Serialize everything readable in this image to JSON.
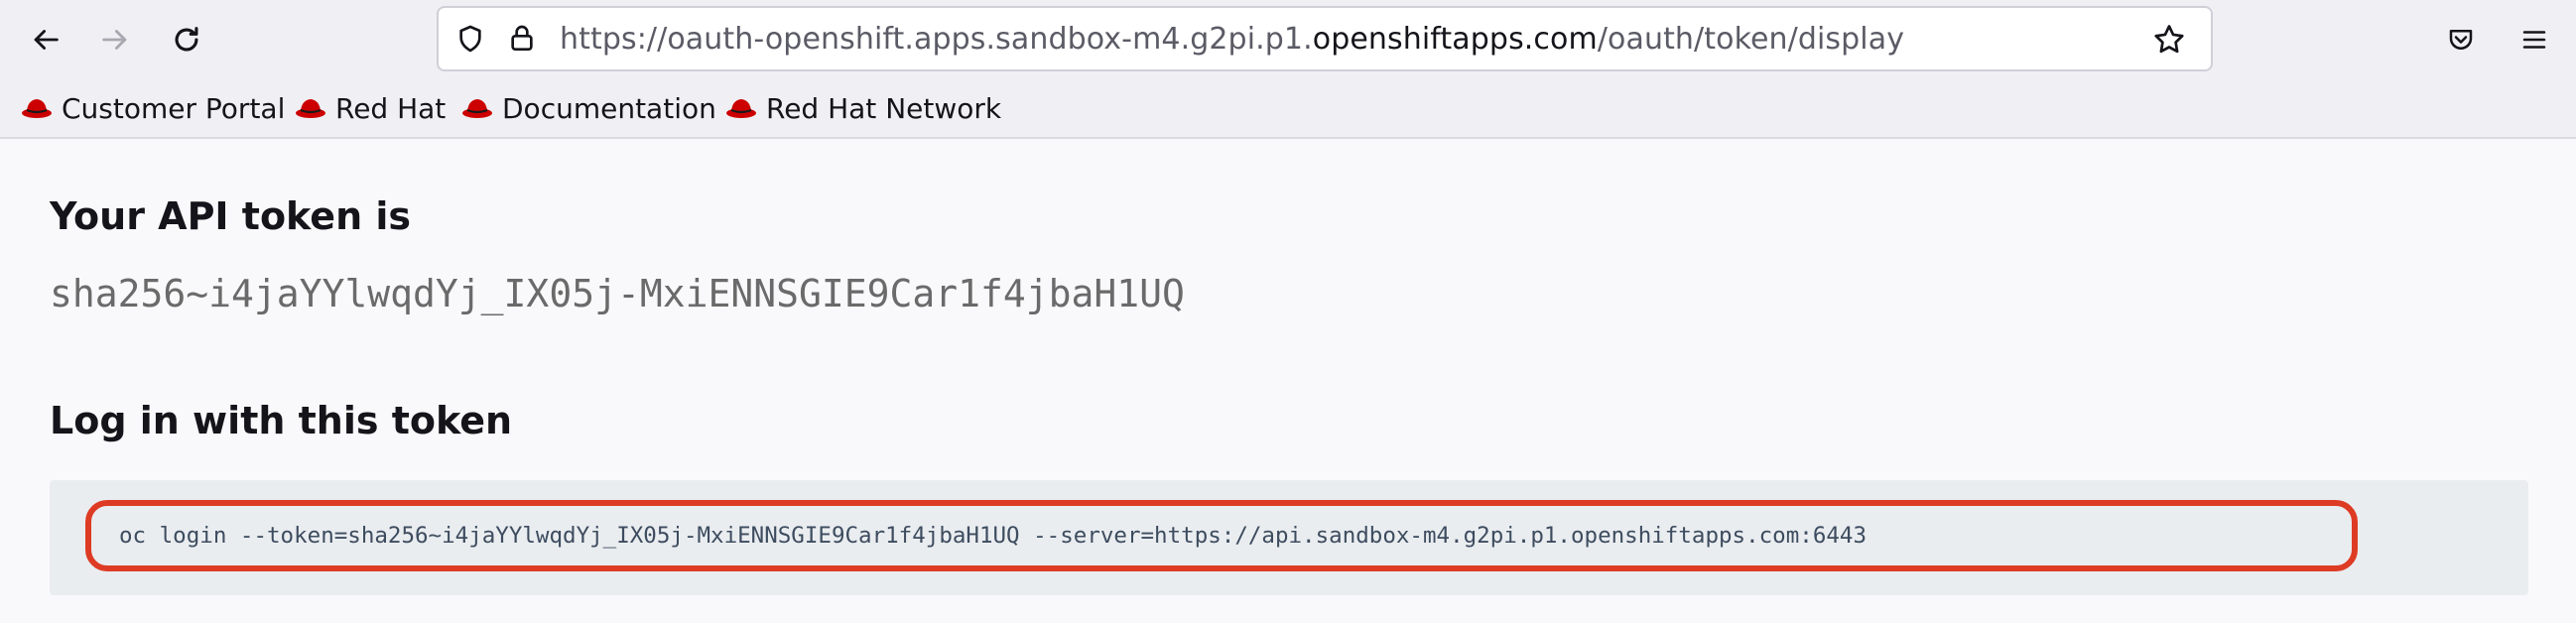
{
  "browser": {
    "url_prefix": "https://oauth-openshift.apps.sandbox-m4.g2pi.p1.",
    "url_domain": "openshiftapps.com",
    "url_path": "/oauth/token/display",
    "icons": {
      "back": "arrow-left-icon",
      "forward": "arrow-right-icon",
      "reload": "reload-icon",
      "tracking": "shield-icon",
      "security": "lock-icon",
      "bookmark": "star-icon",
      "pocket": "pocket-icon",
      "menu": "hamburger-menu-icon"
    }
  },
  "bookmarks": [
    {
      "label": "Customer Portal",
      "icon": "redhat-icon"
    },
    {
      "label": "Red Hat",
      "icon": "redhat-icon"
    },
    {
      "label": "Documentation",
      "icon": "redhat-icon"
    },
    {
      "label": "Red Hat Network",
      "icon": "redhat-icon"
    }
  ],
  "page": {
    "token_heading": "Your API token is",
    "token_value": "sha256~i4jaYYlwqdYj_IX05j-MxiENNSGIE9Car1f4jbaH1UQ",
    "login_heading": "Log in with this token",
    "login_command": "oc login --token=sha256~i4jaYYlwqdYj_IX05j-MxiENNSGIE9Car1f4jbaH1UQ --server=https://api.sandbox-m4.g2pi.p1.openshiftapps.com:6443"
  },
  "colors": {
    "highlight": "#de3b24",
    "redhat": "#cc0000",
    "code_bg": "#eaedf0"
  }
}
